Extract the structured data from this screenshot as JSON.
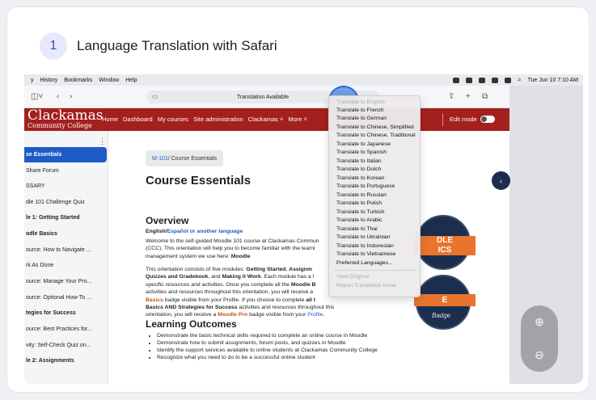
{
  "step": {
    "number": "1",
    "title": "Language Translation with Safari"
  },
  "menubar": {
    "items": [
      "History",
      "Bookmarks",
      "Window",
      "Help"
    ],
    "clock": "Tue Jun 10  7:10 AM"
  },
  "browser": {
    "address": "Translation Available",
    "translate_icon": "translate-icon"
  },
  "site": {
    "logo_line1": "Clackamas",
    "logo_line2": "Community College",
    "nav": [
      "Home",
      "Dashboard",
      "My courses",
      "Site administration",
      "Clackamas ˅",
      "More ˅"
    ],
    "edit_mode": "Edit mode"
  },
  "sidebar": {
    "items": [
      {
        "label": "se Essentials",
        "active": true
      },
      {
        "label": "Share Forum"
      },
      {
        "label": "SSARY"
      },
      {
        "label": "dle 101 Challenge Quiz"
      },
      {
        "label": "le 1: Getting Started",
        "bold": true
      },
      {
        "label": "odle Basics",
        "bold": true
      },
      {
        "label": "ource: How to Navigate ..."
      },
      {
        "label": "rk As Done"
      },
      {
        "label": "ource: Manage Your Pro..."
      },
      {
        "label": "ource: Optional How-To ..."
      },
      {
        "label": "tegies for Success",
        "bold": true
      },
      {
        "label": "ource: Best Practices for..."
      },
      {
        "label": "vity: Self-Check Quiz on..."
      },
      {
        "label": "le 2: Assignments",
        "bold": true
      }
    ]
  },
  "content": {
    "breadcrumb_link": "M-101",
    "breadcrumb_rest": " / Course Essentials",
    "title": "Course Essentials",
    "overview_heading": "Overview",
    "lang_line_a": "English/",
    "lang_line_b": "Español or another language",
    "p1_l1": "Welcome to the self-guided Moodle 101 course at Clackamas Commun",
    "p1_l2": "(CCC). This orientation will help you to become familiar with the learni",
    "p1_l3a": "management system we use here: ",
    "p1_l3b": "Moodle",
    "p2_l1a": "This orientation consists of five modules: ",
    "p2_l1b": "Getting Started",
    "p2_l1c": ", ",
    "p2_l1d": "Assignm",
    "p2_l2a": "Quizzes and Gradebook",
    "p2_l2b": ", and ",
    "p2_l2c": "Making it Work",
    "p2_l2d": ". Each module has a l",
    "p2_l3a": "specific resources and activities. Once you complete all the ",
    "p2_l3b": "Moodle B",
    "p2_l4": "activities and resources throughout this orientation, you will receive a",
    "p2_l5a": "Basics",
    "p2_l5b": " badge visible from your Profile. If you choose to complete ",
    "p2_l5c": "all t",
    "p2_l6a": "Basics AND Strategies for Success",
    "p2_l6b": " activities and resources throughout this",
    "p2_l7a": "orientation, you will receive a ",
    "p2_l7b": "Moodle Pro",
    "p2_l7c": " badge visible from your ",
    "p2_l7d": "Profile",
    "p2_l7e": ".",
    "outcomes_heading": "Learning Outcomes",
    "outcomes": [
      "Demonstrate the basic technical skills required to complete an online course in Moodle",
      "Demonstrate how to submit assignments, forum posts, and quizzes in Moodle",
      "Identify the support services available to online students at Clackamas Community College",
      "Recognize what you need to do to be a successful online student"
    ],
    "badge1_band": "DLE\nICS",
    "badge2_band": "E",
    "badge_script": "Badge"
  },
  "translate_menu": {
    "items": [
      {
        "label": "Translate to English",
        "disabled": true
      },
      {
        "label": "Translate to French"
      },
      {
        "label": "Translate to German"
      },
      {
        "label": "Translate to Chinese, Simplified"
      },
      {
        "label": "Translate to Chinese, Traditional"
      },
      {
        "label": "Translate to Japanese"
      },
      {
        "label": "Translate to Spanish"
      },
      {
        "label": "Translate to Italian"
      },
      {
        "label": "Translate to Dutch"
      },
      {
        "label": "Translate to Korean"
      },
      {
        "label": "Translate to Portuguese"
      },
      {
        "label": "Translate to Russian"
      },
      {
        "label": "Translate to Polish"
      },
      {
        "label": "Translate to Turkish"
      },
      {
        "label": "Translate to Arabic"
      },
      {
        "label": "Translate to Thai"
      },
      {
        "label": "Translate to Ukrainian"
      },
      {
        "label": "Translate to Indonesian"
      },
      {
        "label": "Translate to Vietnamese"
      },
      {
        "label": "Preferred Languages..."
      }
    ],
    "footer_items": [
      {
        "label": "View Original",
        "disabled": true
      },
      {
        "label": "Report Translation Issue",
        "disabled": true
      }
    ]
  },
  "zoom": {
    "in_icon": "zoom-in-icon",
    "out_icon": "zoom-out-icon"
  }
}
